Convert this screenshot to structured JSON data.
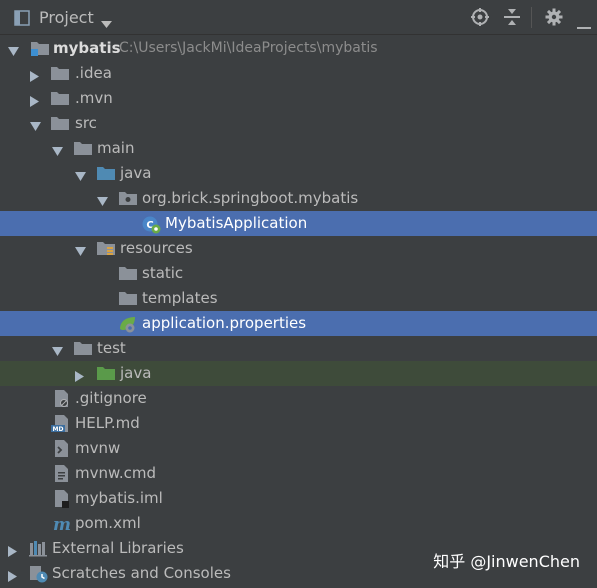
{
  "header": {
    "title": "Project"
  },
  "tree": {
    "root": {
      "label": "mybatis",
      "path": "C:\\Users\\JackMi\\IdeaProjects\\mybatis"
    },
    "idea": "idea",
    "mvn": "mvn",
    "src": "src",
    "main": "main",
    "java": "java",
    "package": "org.brick.springboot.mybatis",
    "app_class": "MybatisApplication",
    "resources": "resources",
    "static": "static",
    "templates": "templates",
    "app_props": "application.properties",
    "test": "test",
    "test_java": "java",
    "gitignore": "gitignore",
    "help": "HELP.md",
    "mvnw": "mvnw",
    "mvnw_cmd": "mvnw.cmd",
    "iml": "mybatis.iml",
    "pom": "pom.xml",
    "external": "External Libraries",
    "scratches": "Scratches and Consoles"
  },
  "watermark": "知乎 @JinwenChen",
  "colors": {
    "background": "#3c3f41",
    "selection": "#4b6eaf",
    "test_highlight": "#3e4b3a",
    "folder": "#8b9199",
    "source_folder": "#4f8ab3",
    "test_folder": "#5a9a4a"
  }
}
